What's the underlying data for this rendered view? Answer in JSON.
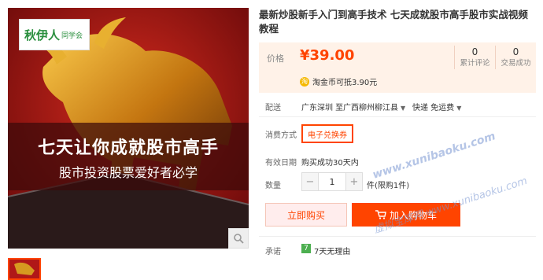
{
  "product": {
    "title": "最新炒股新手入门到高手技术 七天成就股市高手股市实战视频教程"
  },
  "gallery": {
    "brand_main": "秋伊人",
    "brand_sub": "同学会",
    "banner_title": "七天让你成就股市高手",
    "banner_subtitle": "股市投资股票爱好者必学"
  },
  "price": {
    "label": "价格",
    "value": "¥39.00",
    "stats": [
      {
        "num": "0",
        "label": "累计评论"
      },
      {
        "num": "0",
        "label": "交易成功"
      }
    ],
    "coin_text": "淘金币可抵3.90元"
  },
  "shipping": {
    "label": "配送",
    "from": "广东深圳 至",
    "to": "广西柳州柳江县",
    "service": "快递 免运费"
  },
  "payment": {
    "label": "消费方式",
    "option": "电子兑换券"
  },
  "validity": {
    "label": "有效日期",
    "value": "购买成功30天内"
  },
  "quantity": {
    "label": "数量",
    "value": "1",
    "minus": "−",
    "plus": "+",
    "unit": "件(限购1件)"
  },
  "actions": {
    "buy_now": "立即购买",
    "add_cart": "加入购物车"
  },
  "promise": {
    "label": "承诺",
    "icon_text": "7",
    "value": "7天无理由"
  },
  "watermark": {
    "line1": "www.xunibaoku.com",
    "line2": "虚拟宝库网  www.xunibaoku.com"
  },
  "colors": {
    "accent": "#ff4400",
    "price_bg": "#fff2e8",
    "banner_red": "#b01818"
  }
}
